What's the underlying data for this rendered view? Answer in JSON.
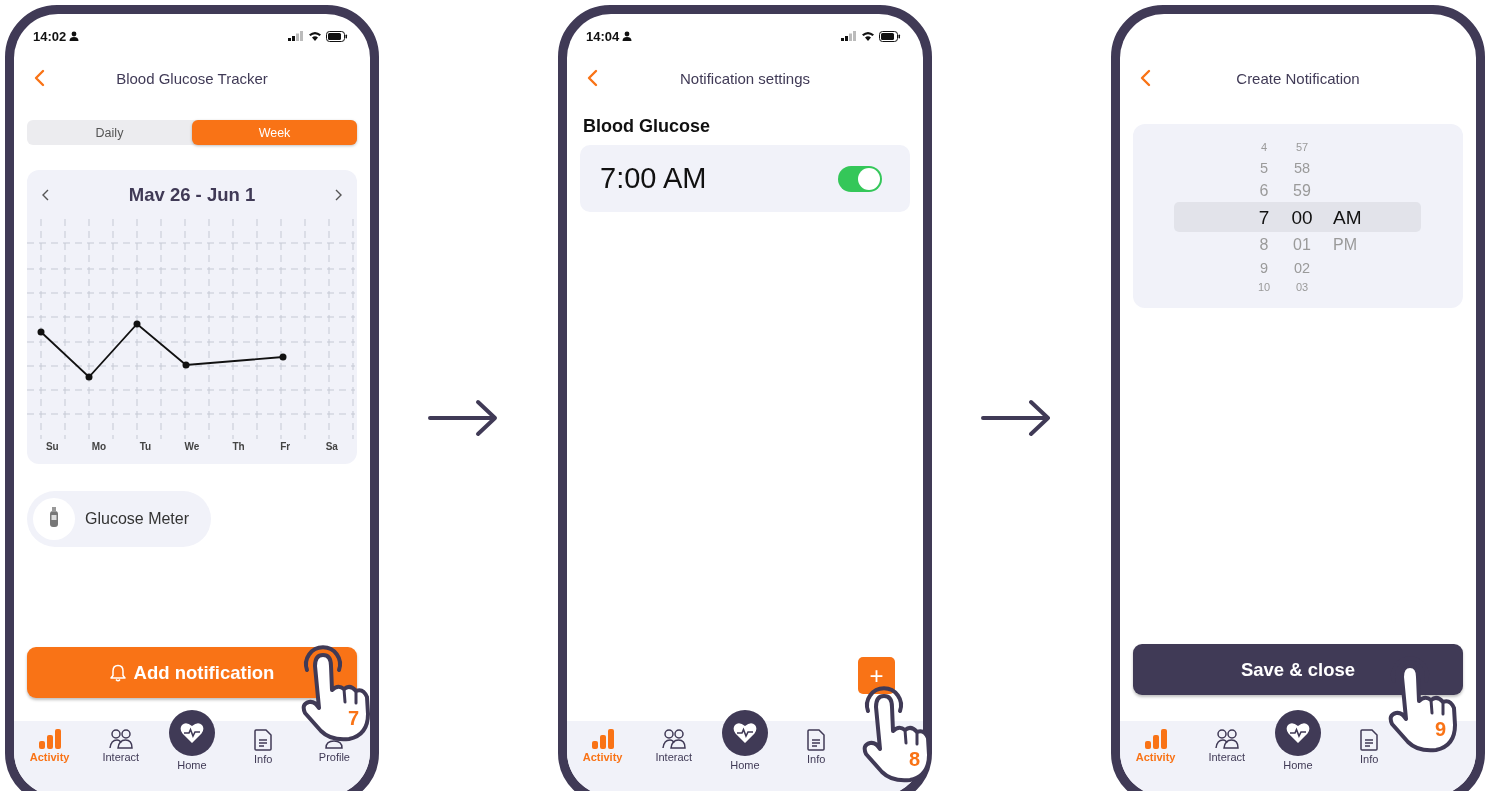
{
  "screens": [
    {
      "kind": "tracker",
      "status_bar": {
        "time": "14:02"
      },
      "header": {
        "title": "Blood Glucose Tracker"
      },
      "segments": [
        {
          "label": "Daily",
          "selected": false
        },
        {
          "label": "Week",
          "selected": true
        }
      ],
      "chart_card": {
        "range": "Mav 26 - Jun 1",
        "day_labels": [
          "Su",
          "Mo",
          "Tu",
          "We",
          "Th",
          "Fr",
          "Sa"
        ]
      },
      "device": {
        "label": "Glucose Meter"
      },
      "action_button": {
        "label": "Add notification"
      },
      "nav": [
        {
          "label": "Activity",
          "selected": true
        },
        {
          "label": "Interact",
          "selected": false
        },
        {
          "label": "Home",
          "selected": false
        },
        {
          "label": "Info",
          "selected": false
        },
        {
          "label": "Profile",
          "selected": false
        }
      ],
      "tap_hint": {
        "step": "7"
      }
    },
    {
      "kind": "settings",
      "status_bar": {
        "time": "14:04"
      },
      "header": {
        "title": "Notification settings"
      },
      "section_title": "Blood Glucose",
      "notifications": [
        {
          "time": "7:00 AM",
          "on": true
        }
      ],
      "add_button": {
        "label": "+"
      },
      "nav": [
        {
          "label": "Activity",
          "selected": true
        },
        {
          "label": "Interact",
          "selected": false
        },
        {
          "label": "Home",
          "selected": false
        },
        {
          "label": "Info",
          "selected": false
        }
      ],
      "tap_hint": {
        "step": "8"
      }
    },
    {
      "kind": "create",
      "header": {
        "title": "Create Notification"
      },
      "picker": {
        "hours": [
          {
            "label": "4",
            "selected": false
          },
          {
            "label": "5",
            "selected": false
          },
          {
            "label": "6",
            "selected": false
          },
          {
            "label": "7",
            "selected": true
          },
          {
            "label": "8",
            "selected": false
          },
          {
            "label": "9",
            "selected": false
          },
          {
            "label": "10",
            "selected": false
          }
        ],
        "minutes": [
          {
            "label": "57",
            "selected": false
          },
          {
            "label": "58",
            "selected": false
          },
          {
            "label": "59",
            "selected": false
          },
          {
            "label": "00",
            "selected": true
          },
          {
            "label": "01",
            "selected": false
          },
          {
            "label": "02",
            "selected": false
          },
          {
            "label": "03",
            "selected": false
          }
        ],
        "periods": [
          {
            "label": "AM",
            "selected": true
          },
          {
            "label": "PM",
            "selected": false
          }
        ]
      },
      "action_button": {
        "label": "Save & close"
      },
      "nav": [
        {
          "label": "Activity",
          "selected": true
        },
        {
          "label": "Interact",
          "selected": false
        },
        {
          "label": "Home",
          "selected": false
        },
        {
          "label": "Info",
          "selected": false
        }
      ],
      "tap_hint": {
        "step": "9"
      }
    }
  ]
}
